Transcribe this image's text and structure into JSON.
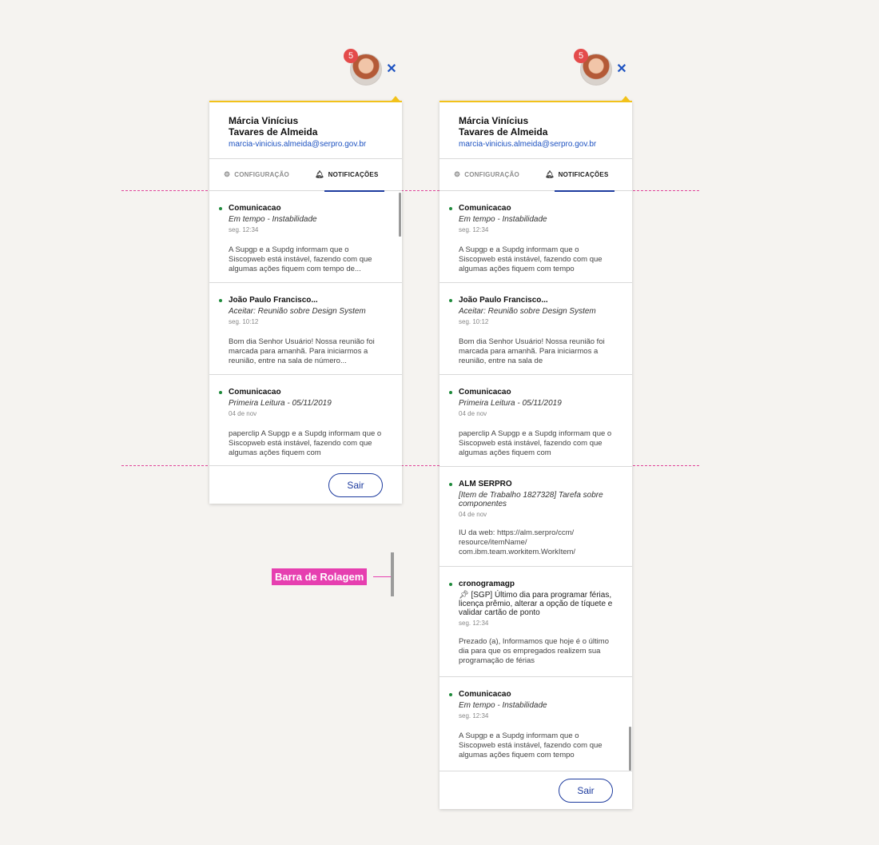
{
  "user": {
    "name_line1": "Márcia Vinícius",
    "name_line2": "Tavares de Almeida",
    "email": "marcia-vinicius.almeida@serpro.gov.br",
    "notification_count": "5"
  },
  "tabs": {
    "config": "CONFIGURAÇÃO",
    "notifications": "NOTIFICAÇÕES"
  },
  "icons": {
    "close": "close-icon",
    "gear": "gear-icon",
    "bell": "bell-icon"
  },
  "colors": {
    "accent_yellow": "#f2c21b",
    "link_blue": "#1d52c1",
    "badge_red": "#e44b4b",
    "unread_green": "#1e8a3b",
    "annotation_pink": "#e63fb0"
  },
  "left_panel": {
    "notifications": [
      {
        "sender": "Comunicacao",
        "subject": "Em tempo - Instabilidade",
        "time": "seg. 12:34",
        "body": "A Supgp e a Supdg informam que o Siscopweb está instável, fazendo com que algumas ações fiquem com tempo de..."
      },
      {
        "sender": "João Paulo Francisco...",
        "subject": "Aceitar: Reunião sobre Design System",
        "time": "seg. 10:12",
        "body": "Bom dia Senhor Usuário!  Nossa reunião foi marcada para amanhã. Para iniciarmos a reunião, entre na sala de número..."
      },
      {
        "sender": "Comunicacao",
        "subject": "Primeira Leitura - 05/11/2019",
        "time": "04 de nov",
        "body": "paperclip  A Supgp e a Supdg informam que o Siscopweb está instável, fazendo com que algumas ações fiquem com"
      }
    ],
    "logout_label": "Sair"
  },
  "right_panel": {
    "notifications": [
      {
        "sender": "Comunicacao",
        "subject": "Em tempo - Instabilidade",
        "time": "seg. 12:34",
        "body": "A Supgp e a Supdg informam que o Siscopweb está instável, fazendo com que algumas ações fiquem com tempo"
      },
      {
        "sender": "João Paulo Francisco...",
        "subject": "Aceitar: Reunião sobre Design System",
        "time": "seg. 10:12",
        "body": "Bom dia Senhor Usuário!  Nossa reunião foi marcada para amanhã. Para iniciarmos a reunião, entre na sala de"
      },
      {
        "sender": "Comunicacao",
        "subject": "Primeira Leitura - 05/11/2019",
        "time": "04 de nov",
        "body": "paperclip  A Supgp e a Supdg informam que o Siscopweb está instável, fazendo com que algumas ações fiquem com"
      },
      {
        "sender": "ALM SERPRO",
        "subject": "[Item de Trabalho 1827328] Tarefa sobre componentes",
        "time": "04 de nov",
        "body": "IU da web: https://alm.serpro/ccm/ resource/itemName/ com.ibm.team.workitem.WorkItem/"
      },
      {
        "sender": "cronogramagp",
        "subject": "[SGP] Último dia para programar férias, licença prêmio, alterar a opção de tíquete e validar cartão de ponto",
        "subject_icon": "pushpin-icon",
        "time": "seg. 12:34",
        "body": "Prezado (a), Informamos que hoje é o último dia para que os empregados realizem sua programação de férias"
      },
      {
        "sender": "Comunicacao",
        "subject": "Em tempo - Instabilidade",
        "time": "seg. 12:34",
        "body": "A Supgp e a Supdg informam que o Siscopweb está instável, fazendo com que algumas ações fiquem com tempo"
      }
    ],
    "logout_label": "Sair"
  },
  "annotation": {
    "label": "Barra de Rolagem"
  }
}
